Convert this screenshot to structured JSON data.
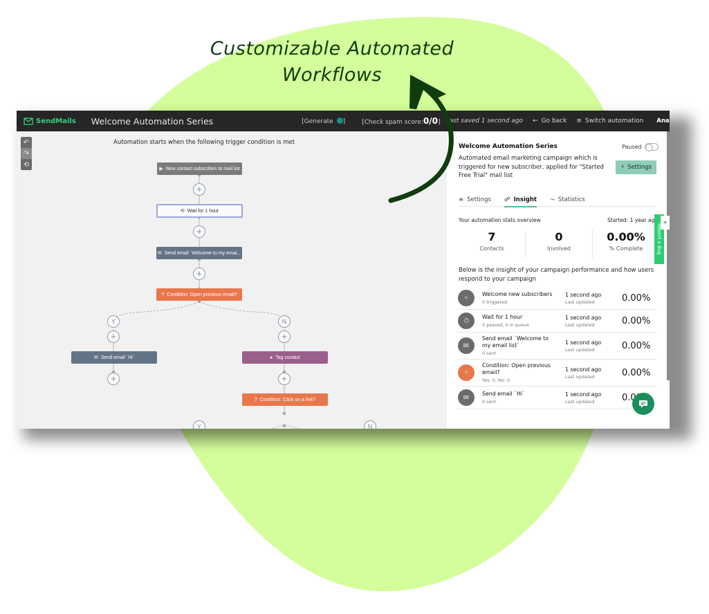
{
  "headline": {
    "line1": "Customizable Automated",
    "line2": "Workflows"
  },
  "colors": {
    "blob": "#d4fd9b",
    "arrow": "#0f3d0c",
    "brand": "#34d17c",
    "accent_tab": "#4fbda6",
    "settings_button": "#8fcdb9",
    "node_trigger": "#7b7b7b",
    "node_email": "#637487",
    "node_condition": "#e8774b",
    "node_tag": "#9a5f8a",
    "bug_tab": "#2ecc71",
    "chat_button": "#1a8f5d"
  },
  "topbar": {
    "brand": "SendMails",
    "title": "Welcome Automation Series",
    "generate": "[Generate",
    "generate_close": "]",
    "spam_prefix": "[Check spam score:",
    "spam_score": "0/0",
    "spam_suffix": "]",
    "last_saved": "Last saved 1 second ago",
    "go_back": "Go back",
    "switch_automation": "Switch automation",
    "user_name": "Anant Gupta"
  },
  "canvas": {
    "trigger_text": "Automation starts when the following trigger condition is met",
    "tools": [
      "undo-icon",
      "redo-icon",
      "history-icon"
    ],
    "nodes": {
      "trigger": "New contact subscribes to mail list",
      "wait": "Wait for 1 hour",
      "send_welcome": "Send email `Welcome to my emai...",
      "condition_open": "Condition: Open previous email?",
      "send_hi": "Send email `Hi`",
      "tag_contact": "Tag contact",
      "condition_click": "Condition: Click on a link?"
    },
    "branch_yes": "Y",
    "branch_no": "N",
    "plus": "+"
  },
  "panel": {
    "title": "Welcome Automation Series",
    "status": "Paused",
    "description": "Automated email marketing campaign which is triggered for new subscriber, applied for \"Started Free Trial\" mail list",
    "settings_button": "Settings",
    "tabs": [
      {
        "label": "Settings",
        "icon": "list-icon"
      },
      {
        "label": "Insight",
        "icon": "insight-icon",
        "active": true
      },
      {
        "label": "Statistics",
        "icon": "chart-icon"
      }
    ],
    "overview_label": "Your automation stats overview",
    "started": "Started: 1 year ago",
    "stats": [
      {
        "value": "7",
        "label": "Contacts"
      },
      {
        "value": "0",
        "label": "Involved"
      },
      {
        "value": "0.00%",
        "label": "% Complete"
      }
    ],
    "insight_text": "Below is the insight of your campaign performance and how users respond to your campaign",
    "rows": [
      {
        "icon": "trigger-icon",
        "title": "Welcome new subscribers",
        "sub": "0 triggered",
        "time": "1 second ago",
        "time_label": "Last updated",
        "pct": "0.00%"
      },
      {
        "icon": "timer-icon",
        "title": "Wait for 1 hour",
        "sub": "0 passed, 0 in queue",
        "time": "1 second ago",
        "time_label": "Last updated",
        "pct": "0.00%"
      },
      {
        "icon": "email-icon",
        "title": "Send email `Welcome to my email list`",
        "sub": "0 sent",
        "time": "1 second ago",
        "time_label": "Last updated",
        "pct": "0.00%"
      },
      {
        "icon": "condition-icon",
        "title": "Condition: Open previous email?",
        "sub": "Yes: 0, No: 0",
        "time": "1 second ago",
        "time_label": "Last updated",
        "pct": "0.00%"
      },
      {
        "icon": "email-icon",
        "title": "Send email `Hi`",
        "sub": "0 sent",
        "time": "1 second ago",
        "time_label": "Last updated",
        "pct": "0.00%"
      }
    ],
    "bug_tab": "Report a Bug",
    "bug_close": "×"
  }
}
